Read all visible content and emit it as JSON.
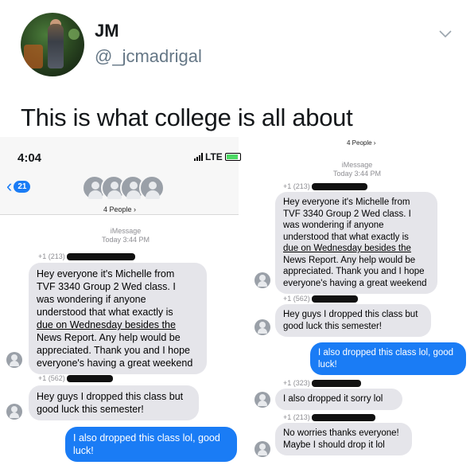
{
  "tweet": {
    "display_name": "JM",
    "handle": "@_jcmadrigal",
    "text": "This is what college is all about",
    "menu_icon": "chevron-down-icon"
  },
  "left_phone": {
    "status": {
      "time": "4:04",
      "network": "LTE"
    },
    "header": {
      "back_badge": "21",
      "people": "4 People ›"
    },
    "imessage_label": "iMessage",
    "imessage_time": "Today 3:44 PM",
    "messages": [
      {
        "sender": "+1 (213)",
        "lines": [
          "Hey everyone it's Michelle from",
          "TVF 3340 Group 2 Wed class. I",
          "was wondering if anyone",
          "understood that what exactly is",
          "due on Wednesday besides the",
          "News Report. Any help would be",
          "appreciated. Thank you and I hope",
          "everyone's having a great weekend"
        ]
      },
      {
        "sender": "+1 (562)",
        "lines": [
          "Hey guys I dropped this class but",
          "good luck this semester!"
        ]
      },
      {
        "sender": "",
        "lines": [
          "I also dropped this class lol, good",
          "luck!"
        ]
      }
    ]
  },
  "right_phone": {
    "top_label": "4 People ›",
    "imessage_label": "iMessage",
    "imessage_time": "Today 3:44 PM",
    "messages": [
      {
        "sender": "+1 (213)",
        "lines": [
          "Hey everyone it's Michelle from",
          "TVF 3340 Group 2 Wed class. I",
          "was wondering if anyone",
          "understood that what exactly is",
          "due on Wednesday besides the",
          "News Report. Any help would be",
          "appreciated. Thank you and I hope",
          "everyone's having a great weekend"
        ]
      },
      {
        "sender": "+1 (562)",
        "lines": [
          "Hey guys I dropped this class but",
          "good luck this semester!"
        ]
      },
      {
        "sender": "",
        "lines": [
          "I also dropped this class lol, good",
          "luck!"
        ]
      },
      {
        "sender": "+1 (323)",
        "lines": [
          "I also dropped it sorry lol"
        ]
      },
      {
        "sender": "+1 (213)",
        "lines": [
          "No worries thanks everyone!",
          "Maybe I should drop it lol"
        ]
      }
    ]
  },
  "colors": {
    "imessage_blue": "#1a7cf5",
    "incoming_gray": "#e5e5ea",
    "twitter_gray": "#657786"
  }
}
